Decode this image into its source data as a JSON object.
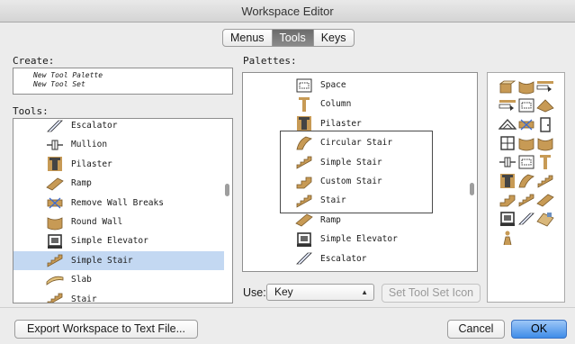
{
  "window": {
    "title": "Workspace Editor"
  },
  "tabs": [
    {
      "label": "Menus"
    },
    {
      "label": "Tools"
    },
    {
      "label": "Keys"
    }
  ],
  "create": {
    "label": "Create:",
    "items": [
      "New Tool Palette",
      "New Tool Set"
    ]
  },
  "tools": {
    "label": "Tools:",
    "items": [
      {
        "label": "Escalator",
        "icon": "escalator-icon"
      },
      {
        "label": "Mullion",
        "icon": "mullion-icon"
      },
      {
        "label": "Pilaster",
        "icon": "pilaster-icon"
      },
      {
        "label": "Ramp",
        "icon": "ramp-icon"
      },
      {
        "label": "Remove Wall Breaks",
        "icon": "remove-wall-breaks-icon"
      },
      {
        "label": "Round Wall",
        "icon": "round-wall-icon"
      },
      {
        "label": "Simple Elevator",
        "icon": "elevator-icon"
      },
      {
        "label": "Simple Stair",
        "icon": "stair-icon",
        "selected": true
      },
      {
        "label": "Slab",
        "icon": "slab-icon"
      },
      {
        "label": "Stair",
        "icon": "stair-icon"
      }
    ]
  },
  "palettes": {
    "label": "Palettes:",
    "items": [
      {
        "label": "Space",
        "icon": "space-icon"
      },
      {
        "label": "Column",
        "icon": "column-icon"
      },
      {
        "label": "Pilaster",
        "icon": "pilaster-icon"
      },
      {
        "label": "Circular Stair",
        "icon": "circular-stair-icon"
      },
      {
        "label": "Simple Stair",
        "icon": "stair-icon"
      },
      {
        "label": "Custom Stair",
        "icon": "custom-stair-icon"
      },
      {
        "label": "Stair",
        "icon": "stair-icon"
      },
      {
        "label": "Ramp",
        "icon": "ramp-icon"
      },
      {
        "label": "Simple Elevator",
        "icon": "elevator-icon"
      },
      {
        "label": "Escalator",
        "icon": "escalator-icon"
      }
    ]
  },
  "use": {
    "label": "Use:",
    "value": "Key",
    "set_icon_label": "Set Tool Set Icon"
  },
  "footer": {
    "export_label": "Export Workspace to Text File...",
    "cancel_label": "Cancel",
    "ok_label": "OK"
  },
  "colors": {
    "selection": "#c3d8f2",
    "accent": "#3f8ce8",
    "wood": "#c79a55",
    "dark": "#4d4d4d"
  }
}
